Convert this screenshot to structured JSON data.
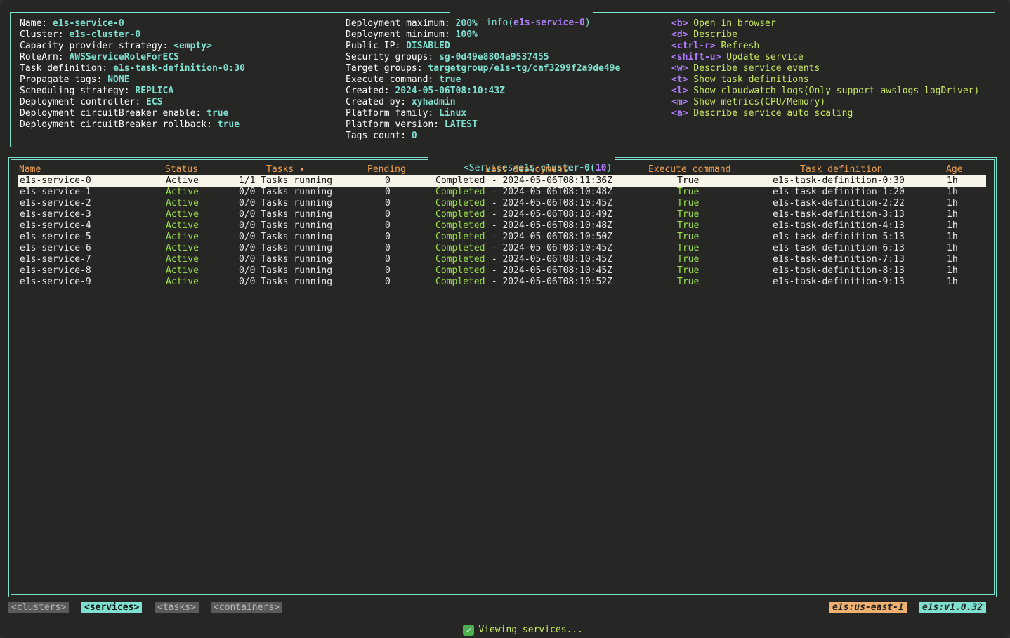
{
  "info_panel": {
    "title_prefix": "info(",
    "title_name": "e1s-service-0",
    "title_suffix": ")",
    "col1": [
      {
        "k": "Name: ",
        "v": "e1s-service-0"
      },
      {
        "k": "Cluster: ",
        "v": "e1s-cluster-0"
      },
      {
        "k": "Capacity provider strategy: ",
        "v": "<empty>"
      },
      {
        "k": "RoleArn: ",
        "v": "AWSServiceRoleForECS"
      },
      {
        "k": "Task definition: ",
        "v": "e1s-task-definition-0:30"
      },
      {
        "k": "Propagate tags: ",
        "v": "NONE"
      },
      {
        "k": "Scheduling strategy: ",
        "v": "REPLICA"
      },
      {
        "k": "Deployment controller: ",
        "v": "ECS"
      },
      {
        "k": "Deployment circuitBreaker enable: ",
        "v": "true"
      },
      {
        "k": "Deployment circuitBreaker rollback: ",
        "v": "true"
      }
    ],
    "col2": [
      {
        "k": "Deployment maximum: ",
        "v": "200%"
      },
      {
        "k": "Deployment minimum: ",
        "v": "100%"
      },
      {
        "k": "Public IP: ",
        "v": "DISABLED"
      },
      {
        "k": "Security groups: ",
        "v": "sg-0d49e8804a9537455"
      },
      {
        "k": "Target groups: ",
        "v": "targetgroup/e1s-tg/caf3299f2a9de49e"
      },
      {
        "k": "Execute command: ",
        "v": "true"
      },
      {
        "k": "Created: ",
        "v": "2024-05-06T08:10:43Z"
      },
      {
        "k": "Created by: ",
        "v": "xyhadmin"
      },
      {
        "k": "Platform family: ",
        "v": "Linux"
      },
      {
        "k": "Platform version: ",
        "v": "LATEST"
      },
      {
        "k": "Tags count: ",
        "v": "0"
      }
    ],
    "hotkeys": [
      {
        "key": "<b>",
        "desc": " Open in browser"
      },
      {
        "key": "<d>",
        "desc": " Describe"
      },
      {
        "key": "<ctrl-r>",
        "desc": " Refresh"
      },
      {
        "key": "<shift-u>",
        "desc": " Update service"
      },
      {
        "key": "<w>",
        "desc": " Describe service events"
      },
      {
        "key": "<t>",
        "desc": " Show task definitions"
      },
      {
        "key": "<l>",
        "desc": " Show cloudwatch logs(Only support awslogs logDriver)"
      },
      {
        "key": "<m>",
        "desc": " Show metrics(CPU/Memory)"
      },
      {
        "key": "<a>",
        "desc": " Describe service auto scaling"
      }
    ]
  },
  "services_panel": {
    "title_tag": "<Services>",
    "title_cluster": "e1s-cluster-0(",
    "title_count": "10",
    "title_close": ")",
    "headers": {
      "name": "Name",
      "status": "Status",
      "tasks": "Tasks ▾",
      "pending": "Pending",
      "last_deployment": "Last deployment",
      "execute_command": "Execute command",
      "task_definition": "Task definition",
      "age": "Age"
    },
    "rows": [
      {
        "name": "e1s-service-0",
        "status": "Active",
        "tasks": "1/1 Tasks running",
        "pending": "0",
        "deploy_status": "Completed",
        "deploy_time": " - 2024-05-06T08:11:36Z",
        "exec": "True",
        "taskdef": "e1s-task-definition-0:30",
        "age": "1h"
      },
      {
        "name": "e1s-service-1",
        "status": "Active",
        "tasks": "0/0 Tasks running",
        "pending": "0",
        "deploy_status": "Completed",
        "deploy_time": " - 2024-05-06T08:10:48Z",
        "exec": "True",
        "taskdef": "e1s-task-definition-1:20",
        "age": "1h"
      },
      {
        "name": "e1s-service-2",
        "status": "Active",
        "tasks": "0/0 Tasks running",
        "pending": "0",
        "deploy_status": "Completed",
        "deploy_time": " - 2024-05-06T08:10:45Z",
        "exec": "True",
        "taskdef": "e1s-task-definition-2:22",
        "age": "1h"
      },
      {
        "name": "e1s-service-3",
        "status": "Active",
        "tasks": "0/0 Tasks running",
        "pending": "0",
        "deploy_status": "Completed",
        "deploy_time": " - 2024-05-06T08:10:49Z",
        "exec": "True",
        "taskdef": "e1s-task-definition-3:13",
        "age": "1h"
      },
      {
        "name": "e1s-service-4",
        "status": "Active",
        "tasks": "0/0 Tasks running",
        "pending": "0",
        "deploy_status": "Completed",
        "deploy_time": " - 2024-05-06T08:10:48Z",
        "exec": "True",
        "taskdef": "e1s-task-definition-4:13",
        "age": "1h"
      },
      {
        "name": "e1s-service-5",
        "status": "Active",
        "tasks": "0/0 Tasks running",
        "pending": "0",
        "deploy_status": "Completed",
        "deploy_time": " - 2024-05-06T08:10:50Z",
        "exec": "True",
        "taskdef": "e1s-task-definition-5:13",
        "age": "1h"
      },
      {
        "name": "e1s-service-6",
        "status": "Active",
        "tasks": "0/0 Tasks running",
        "pending": "0",
        "deploy_status": "Completed",
        "deploy_time": " - 2024-05-06T08:10:45Z",
        "exec": "True",
        "taskdef": "e1s-task-definition-6:13",
        "age": "1h"
      },
      {
        "name": "e1s-service-7",
        "status": "Active",
        "tasks": "0/0 Tasks running",
        "pending": "0",
        "deploy_status": "Completed",
        "deploy_time": " - 2024-05-06T08:10:45Z",
        "exec": "True",
        "taskdef": "e1s-task-definition-7:13",
        "age": "1h"
      },
      {
        "name": "e1s-service-8",
        "status": "Active",
        "tasks": "0/0 Tasks running",
        "pending": "0",
        "deploy_status": "Completed",
        "deploy_time": " - 2024-05-06T08:10:45Z",
        "exec": "True",
        "taskdef": "e1s-task-definition-8:13",
        "age": "1h"
      },
      {
        "name": "e1s-service-9",
        "status": "Active",
        "tasks": "0/0 Tasks running",
        "pending": "0",
        "deploy_status": "Completed",
        "deploy_time": " - 2024-05-06T08:10:52Z",
        "exec": "True",
        "taskdef": "e1s-task-definition-9:13",
        "age": "1h"
      }
    ]
  },
  "bottom_bar": {
    "tabs": [
      "<clusters>",
      "<services>",
      "<tasks>",
      "<containers>"
    ],
    "region_badge": "e1s:us-east-1",
    "version_badge": "e1s:v1.0.32",
    "status_icon": "check-icon",
    "status_text": "Viewing services..."
  },
  "colors": {
    "border": "#7fe0d0",
    "value": "#7fe0d0",
    "hotkey": "#b07cff",
    "hotkey_desc": "#c8e860",
    "header": "#f0a050",
    "active_green": "#9be04a",
    "background": "#262624"
  }
}
